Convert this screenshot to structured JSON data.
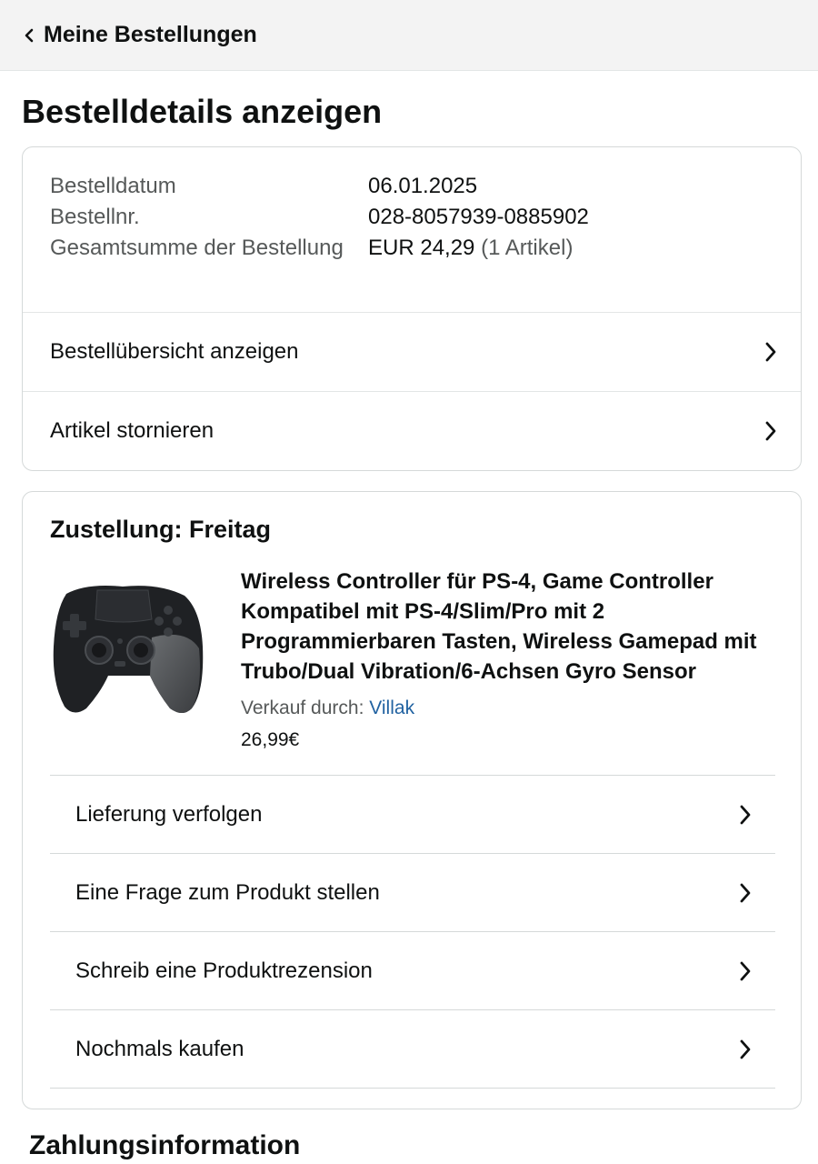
{
  "header": {
    "back_label": "Meine Bestellungen",
    "back_icon": "chevron-left-icon"
  },
  "page_title": "Bestelldetails anzeigen",
  "order_summary": {
    "date_label": "Bestelldatum",
    "date_value": "06.01.2025",
    "number_label": "Bestellnr.",
    "number_value": "028-8057939-0885902",
    "total_label": "Gesamtsumme der Bestellung",
    "total_value": "EUR 24,29",
    "total_items": "(1 Artikel)",
    "links": [
      {
        "label": "Bestellübersicht anzeigen"
      },
      {
        "label": "Artikel stornieren"
      }
    ]
  },
  "delivery": {
    "heading": "Zustellung: Freitag",
    "product": {
      "title": "Wireless Controller für PS-4, Game Controller Kompatibel mit PS-4/Slim/Pro mit 2 Programmierbaren Tasten, Wireless Gamepad mit Trubo/Dual Vibration/6-Achsen Gyro Sensor",
      "seller_prefix": "Verkauf durch:",
      "seller_name": "Villak",
      "price": "26,99€",
      "image_icon": "game-controller-image"
    },
    "actions": [
      {
        "label": "Lieferung verfolgen"
      },
      {
        "label": "Eine Frage zum Produkt stellen"
      },
      {
        "label": "Schreib eine Produktrezension"
      },
      {
        "label": "Nochmals kaufen"
      }
    ]
  },
  "payment": {
    "heading": "Zahlungsinformation"
  },
  "colors": {
    "link": "#2162a1",
    "text": "#0f1111",
    "muted": "#565959",
    "border": "#d5d9d9",
    "header_bg": "#f3f3f3"
  }
}
